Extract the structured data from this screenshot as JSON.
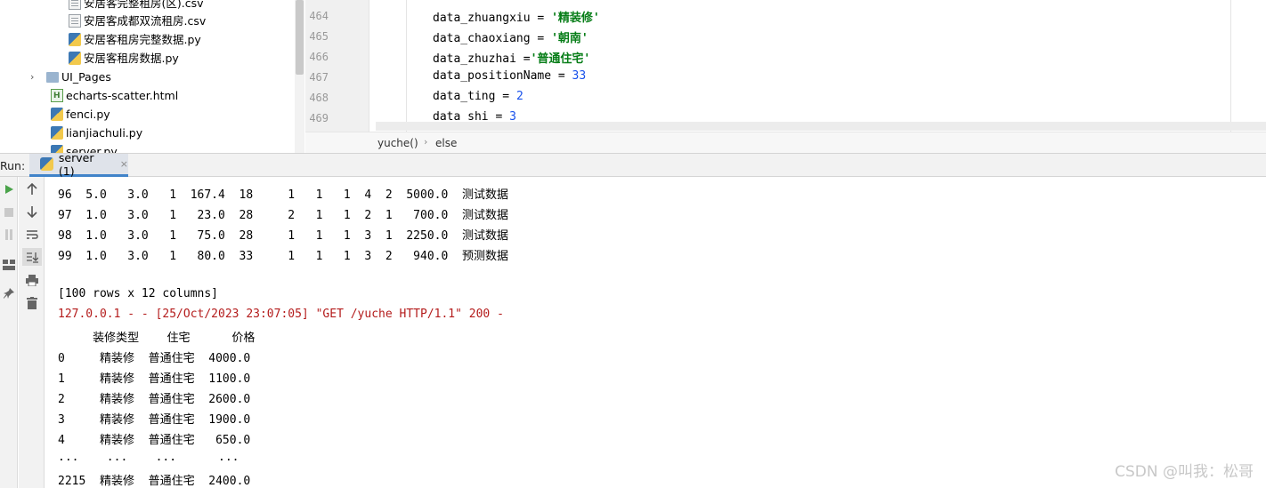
{
  "project_tree": {
    "items": [
      {
        "label": "安居客完整租房(区).csv",
        "type": "csv"
      },
      {
        "label": "安居客成都双流租房.csv",
        "type": "csv"
      },
      {
        "label": "安居客租房完整数据.py",
        "type": "py"
      },
      {
        "label": "安居客租房数据.py",
        "type": "py"
      },
      {
        "label": "UI_Pages",
        "type": "folder"
      },
      {
        "label": "echarts-scatter.html",
        "type": "html"
      },
      {
        "label": "fenci.py",
        "type": "py"
      },
      {
        "label": "lianjiachuli.py",
        "type": "py"
      },
      {
        "label": "server.py",
        "type": "py"
      }
    ],
    "chevron": "›"
  },
  "editor": {
    "lines": [
      {
        "num": "464",
        "var": "data_zhuangxiu",
        "op": " = ",
        "val": "'精装修'",
        "kind": "str"
      },
      {
        "num": "465",
        "var": "data_chaoxiang",
        "op": " = ",
        "val": "'朝南'",
        "kind": "str"
      },
      {
        "num": "466",
        "var": "data_zhuzhai",
        "op": " =",
        "val": "'普通住宅'",
        "kind": "str"
      },
      {
        "num": "467",
        "var": "data_positionName",
        "op": " = ",
        "val": "33",
        "kind": "num"
      },
      {
        "num": "468",
        "var": "data_ting",
        "op": " = ",
        "val": "2",
        "kind": "num"
      },
      {
        "num": "469",
        "var": "data_shi",
        "op": " = ",
        "val": "3",
        "kind": "num"
      }
    ],
    "breadcrumb": [
      "yuche()",
      "else"
    ],
    "breadcrumb_sep": "›"
  },
  "run": {
    "label": "Run:",
    "tab_label": "server (1)",
    "close": "×"
  },
  "console": {
    "lines": [
      {
        "text": "96  5.0   3.0   1  167.4  18     1   1   1  4  2  5000.0  ",
        "tag": "测试数据",
        "style": "normal"
      },
      {
        "text": "97  1.0   3.0   1   23.0  28     2   1   1  2  1   700.0  ",
        "tag": "测试数据",
        "style": "normal"
      },
      {
        "text": "98  1.0   3.0   1   75.0  28     1   1   1  3  1  2250.0  ",
        "tag": "测试数据",
        "style": "normal"
      },
      {
        "text": "99  1.0   3.0   1   80.0  33     1   1   1  3  2   940.0  ",
        "tag": "预测数据",
        "style": "normal"
      },
      {
        "text": "",
        "tag": "",
        "style": "normal"
      },
      {
        "text": "[100 rows x 12 columns]",
        "tag": "",
        "style": "normal"
      },
      {
        "text": "127.0.0.1 - - [25/Oct/2023 23:07:05] \"GET /yuche HTTP/1.1\" 200 -",
        "tag": "",
        "style": "red"
      },
      {
        "text": "     装修类型    住宅      价格",
        "tag": "",
        "style": "normal"
      },
      {
        "text": "0     精装修  普通住宅  4000.0",
        "tag": "",
        "style": "normal"
      },
      {
        "text": "1     精装修  普通住宅  1100.0",
        "tag": "",
        "style": "normal"
      },
      {
        "text": "2     精装修  普通住宅  2600.0",
        "tag": "",
        "style": "normal"
      },
      {
        "text": "3     精装修  普通住宅  1900.0",
        "tag": "",
        "style": "normal"
      },
      {
        "text": "4     精装修  普通住宅   650.0",
        "tag": "",
        "style": "normal"
      },
      {
        "text": "...    ...    ...      ...",
        "tag": "",
        "style": "normal"
      },
      {
        "text": "2215  精装修  普通住宅  2400.0",
        "tag": "",
        "style": "normal"
      }
    ],
    "watermark": "CSDN @叫我：松哥"
  }
}
